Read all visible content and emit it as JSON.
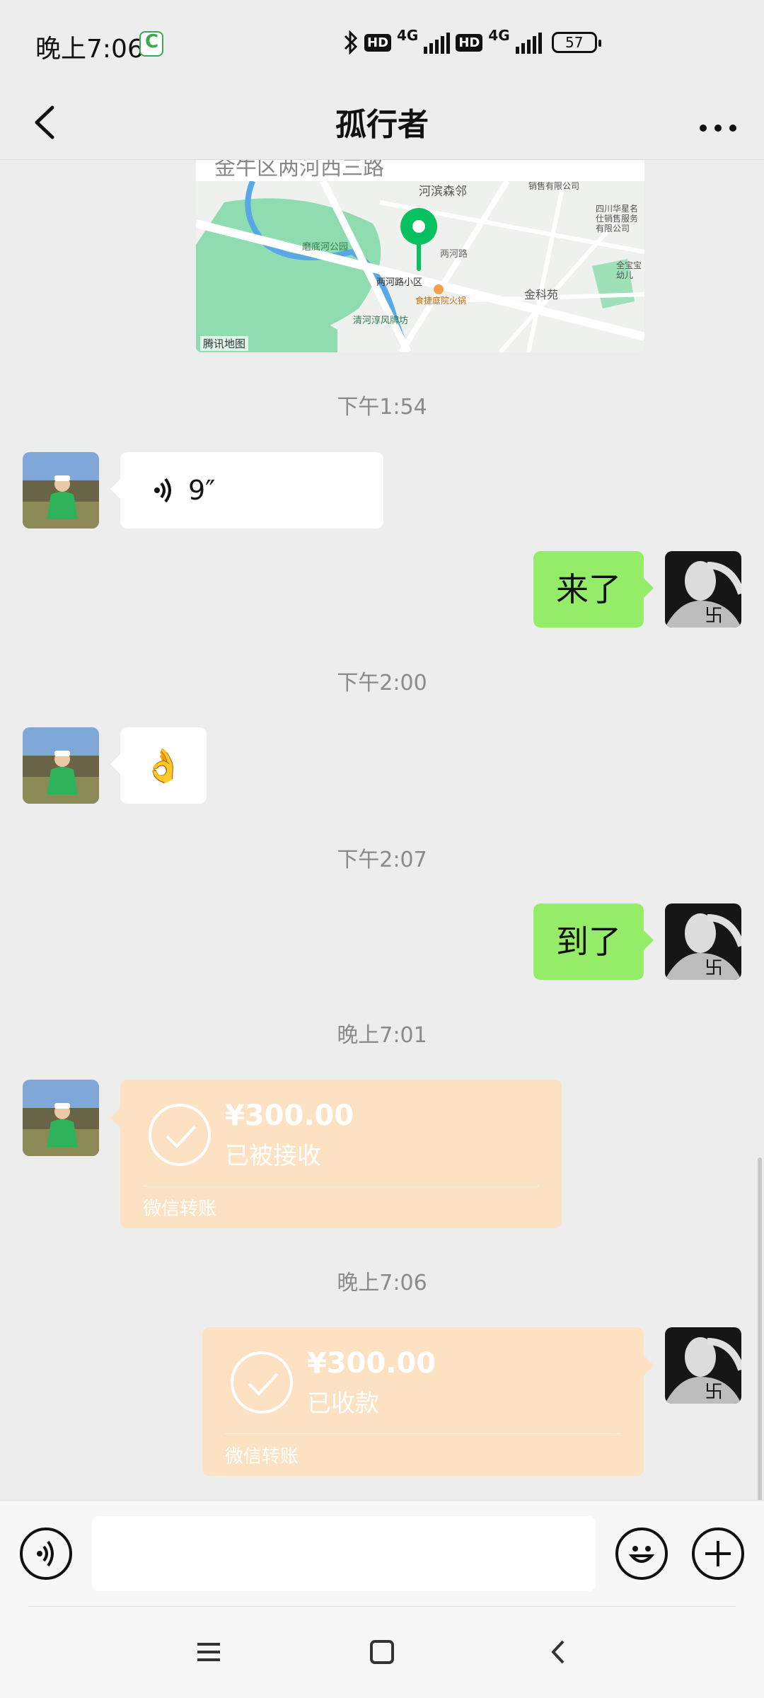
{
  "status_bar": {
    "time": "晚上7:06",
    "network_1": "4G",
    "network_2": "4G",
    "hd_1": "HD",
    "hd_2": "HD",
    "battery": "57"
  },
  "header": {
    "title": "孤行者"
  },
  "map": {
    "address_partial": "金牛区两河西三路",
    "labels": {
      "river_community": "河滨森邻",
      "park": "磨底河公园",
      "lianghelu": "两河路",
      "community": "两河路小区",
      "restaurant": "食捷庭院火锅",
      "jinkeyuan": "金科苑",
      "qinghe": "清河淳风牌坊",
      "company": "四川华星名仕销售服务有限公司",
      "sales": "销售有限公司",
      "kindergarten": "全宝宝幼儿",
      "tencent": "腾讯地图"
    }
  },
  "messages": [
    {
      "type": "time",
      "text": "下午1:54"
    },
    {
      "type": "voice",
      "side": "left",
      "duration": "9″"
    },
    {
      "type": "text",
      "side": "right",
      "text": "来了"
    },
    {
      "type": "time",
      "text": "下午2:00"
    },
    {
      "type": "emoji",
      "side": "left",
      "emoji": "👌"
    },
    {
      "type": "time",
      "text": "下午2:07"
    },
    {
      "type": "text",
      "side": "right",
      "text": "到了"
    },
    {
      "type": "time",
      "text": "晚上7:01"
    },
    {
      "type": "transfer",
      "side": "left",
      "amount": "¥300.00",
      "status": "已被接收",
      "label": "微信转账"
    },
    {
      "type": "time",
      "text": "晚上7:06"
    },
    {
      "type": "transfer",
      "side": "right",
      "amount": "¥300.00",
      "status": "已收款",
      "label": "微信转账"
    }
  ],
  "colors": {
    "background": "#ededed",
    "my_bubble": "#95ec69",
    "their_bubble": "#ffffff",
    "transfer_card": "#fce1c3",
    "map_pin": "#07c160"
  },
  "icons": {
    "back": "back-arrow-icon",
    "more": "more-dots-icon",
    "voice_input": "voice-icon",
    "emoji": "emoji-icon",
    "plus": "plus-icon",
    "nav_menu": "menu-icon",
    "nav_home": "home-icon",
    "nav_back": "nav-back-icon"
  }
}
